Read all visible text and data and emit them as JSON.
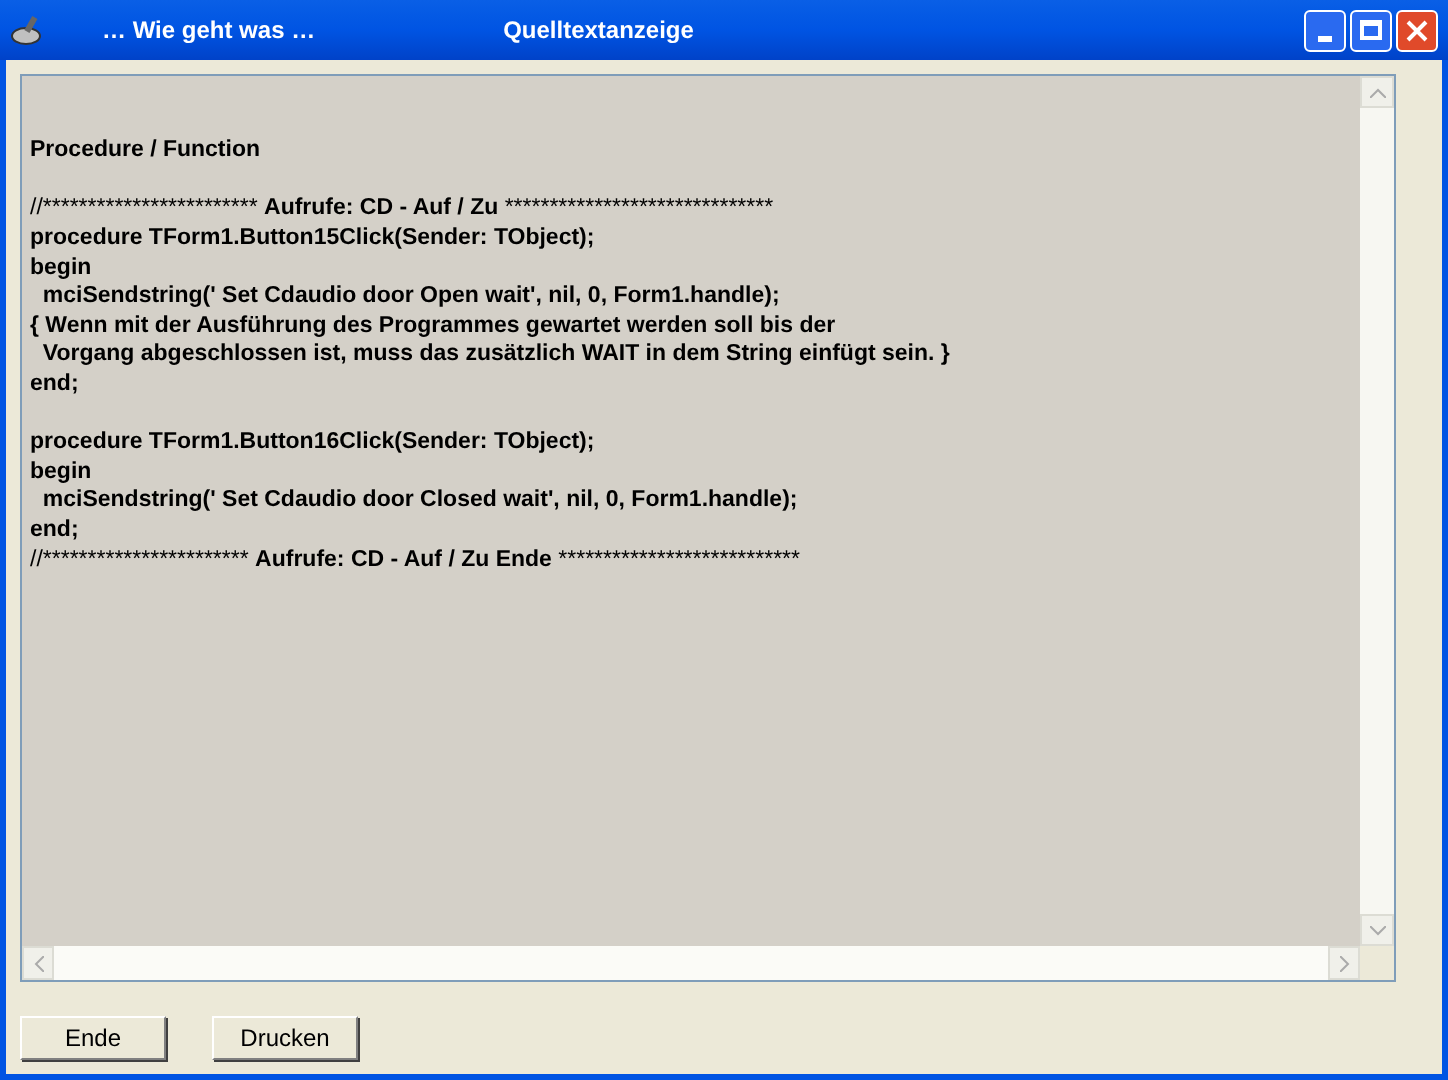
{
  "window": {
    "title_left": "… Wie geht was …",
    "title": "Quelltextanzeige"
  },
  "memo": {
    "lines": [
      {
        "kind": "blank"
      },
      {
        "kind": "blank"
      },
      {
        "kind": "code",
        "text": "Procedure / Function"
      },
      {
        "kind": "blank"
      },
      {
        "kind": "comment",
        "prefix": "//************************",
        "label": "Aufrufe: CD - Auf / Zu",
        "suffix": "******************************"
      },
      {
        "kind": "code",
        "text": "procedure TForm1.Button15Click(Sender: TObject);"
      },
      {
        "kind": "code",
        "text": "begin"
      },
      {
        "kind": "code",
        "text": "  mciSendstring(' Set Cdaudio door Open wait', nil, 0, Form1.handle);"
      },
      {
        "kind": "code",
        "text": "{ Wenn mit der Ausführung des Programmes gewartet werden soll bis der"
      },
      {
        "kind": "code",
        "text": "  Vorgang abgeschlossen ist, muss das zusätzlich WAIT in dem String einfügt sein. }"
      },
      {
        "kind": "code",
        "text": "end;"
      },
      {
        "kind": "blank"
      },
      {
        "kind": "code",
        "text": "procedure TForm1.Button16Click(Sender: TObject);"
      },
      {
        "kind": "code",
        "text": "begin"
      },
      {
        "kind": "code",
        "text": "  mciSendstring(' Set Cdaudio door Closed wait', nil, 0, Form1.handle);"
      },
      {
        "kind": "code",
        "text": "end;"
      },
      {
        "kind": "comment",
        "prefix": "//***********************",
        "label": "Aufrufe: CD - Auf / Zu Ende",
        "suffix": "***************************"
      }
    ]
  },
  "buttons": [
    "Ende",
    "Drucken"
  ]
}
